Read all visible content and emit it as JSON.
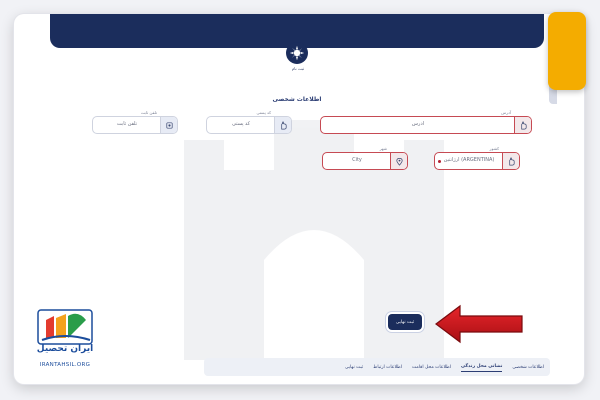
{
  "header": {
    "logo_caption": "ثبت نام"
  },
  "section_title": "اطلاعات شخصی",
  "fields": {
    "address": {
      "label": "آدرس",
      "value": "آدرس"
    },
    "postal_code": {
      "label": "کد پستی",
      "value": "کد پستی"
    },
    "landline": {
      "label": "تلفن ثابت",
      "value": "تلفن ثابت"
    },
    "country": {
      "label": "کشور",
      "value": "آرژانتین (ARGENTINA)"
    },
    "city": {
      "label": "شهر",
      "value": "City"
    }
  },
  "submit_label": "ثبت نهایی",
  "tabs": [
    {
      "label": "اطلاعات شخصی",
      "active": false
    },
    {
      "label": "نشانی محل زندگی",
      "active": true
    },
    {
      "label": "اطلاعات محل اقامت",
      "active": false
    },
    {
      "label": "اطلاعات ارتباط",
      "active": false
    },
    {
      "label": "ثبت نهایی",
      "active": false
    }
  ],
  "brand": {
    "name": "ایران تحصیل",
    "domain": "IRANTAHSIL.ORG"
  },
  "colors": {
    "header": "#1b2d5c",
    "accent_yellow": "#f4ac00",
    "arrow_red": "#c8151b",
    "required_border": "#c64a53"
  },
  "icons": {
    "logo": "emblem-icon",
    "field": "hand-icon",
    "city": "location-pin-icon",
    "arrow": "red-arrow-icon"
  }
}
